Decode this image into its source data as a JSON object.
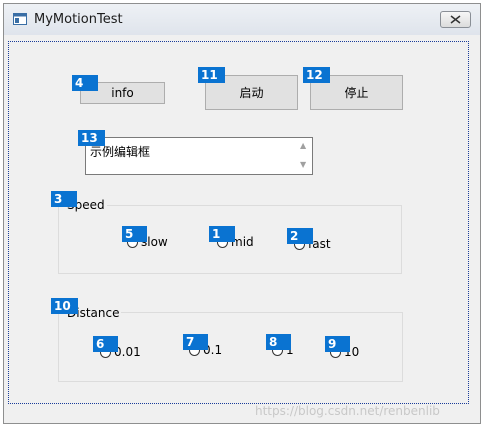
{
  "window": {
    "title": "MyMotionTest"
  },
  "buttons": {
    "info": "info",
    "start": "启动",
    "stop": "停止"
  },
  "edit": {
    "text": "示例编辑框"
  },
  "speed": {
    "title": "Speed",
    "options": [
      "slow",
      "mid",
      "fast"
    ]
  },
  "distance": {
    "title": "Distance",
    "options": [
      "0.01",
      "0.1",
      "1",
      "10"
    ]
  },
  "badges": {
    "b1": "1",
    "b2": "2",
    "b3": "3",
    "b4": "4",
    "b5": "5",
    "b6": "6",
    "b7": "7",
    "b8": "8",
    "b9": "9",
    "b10": "10",
    "b11": "11",
    "b12": "12",
    "b13": "13"
  },
  "watermark": "https://blog.csdn.net/renbenlib",
  "colors": {
    "badge": "#0a73d1",
    "client_border": "#1a3c99"
  },
  "icons": {
    "app": "window-icon",
    "close": "close-x-icon",
    "scroll_up": "chevron-up-icon",
    "scroll_down": "chevron-down-icon"
  }
}
